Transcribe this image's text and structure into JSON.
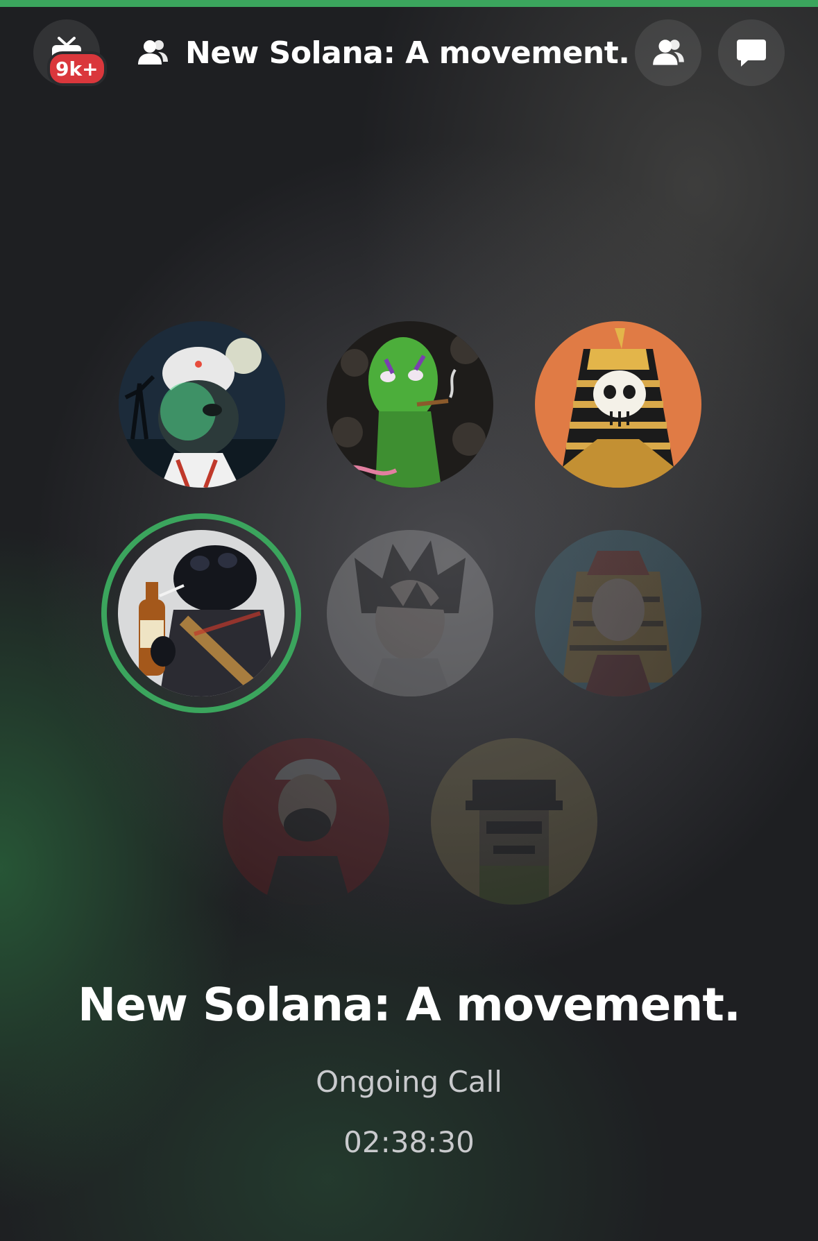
{
  "colors": {
    "accent_green": "#3ba55d",
    "badge_red": "#da373c",
    "text_secondary": "#c9cacd"
  },
  "header": {
    "back_icon": "tv-icon",
    "notification_badge": "9k+",
    "title_icon": "group-icon",
    "title": "New Solana: A movement.",
    "participants_icon": "participants-icon",
    "chat_icon": "chat-bubble-icon"
  },
  "participants": [
    {
      "avatar": "hooded-creature-halloween-avatar",
      "speaking": false,
      "active": true
    },
    {
      "avatar": "green-zombie-avatar",
      "speaking": false,
      "active": true
    },
    {
      "avatar": "pharaoh-skull-avatar",
      "speaking": false,
      "active": true
    },
    {
      "avatar": "frog-with-bottle-avatar",
      "speaking": true,
      "active": true
    },
    {
      "avatar": "anime-boy-avatar",
      "speaking": false,
      "active": false
    },
    {
      "avatar": "pharaoh-boy-avatar",
      "speaking": false,
      "active": false
    },
    {
      "avatar": "masked-figure-avatar",
      "speaking": false,
      "active": false
    },
    {
      "avatar": "pixel-character-avatar",
      "speaking": false,
      "active": false
    }
  ],
  "call": {
    "title": "New Solana: A movement.",
    "status": "Ongoing Call",
    "duration": "02:38:30"
  }
}
